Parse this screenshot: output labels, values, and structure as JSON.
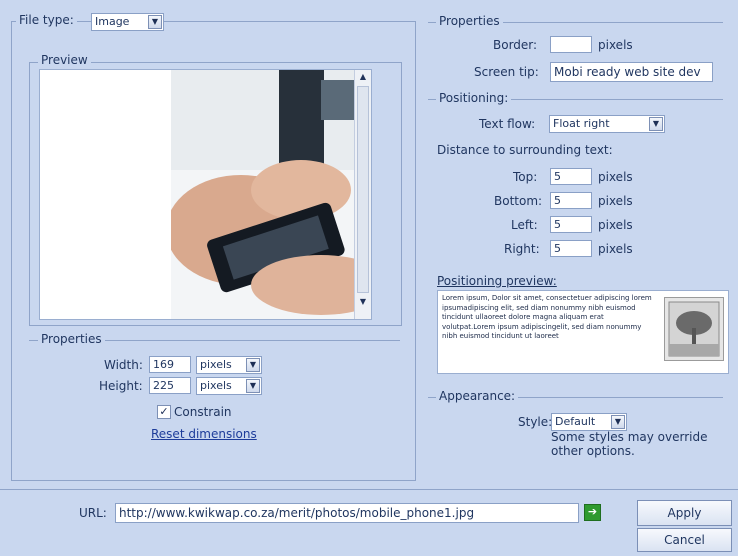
{
  "file_type": {
    "label": "File type:",
    "value": "Image"
  },
  "preview": {
    "legend": "Preview"
  },
  "left_properties": {
    "legend": "Properties",
    "width_label": "Width:",
    "width_value": "169",
    "width_unit": "pixels",
    "height_label": "Height:",
    "height_value": "225",
    "height_unit": "pixels",
    "constrain_label": "Constrain",
    "constrain_checked": true,
    "reset_label": "Reset dimensions"
  },
  "right_properties": {
    "legend": "Properties",
    "border_label": "Border:",
    "border_value": "",
    "border_unit": "pixels",
    "screentip_label": "Screen tip:",
    "screentip_value": "Mobi ready web site dev"
  },
  "positioning": {
    "legend": "Positioning:",
    "textflow_label": "Text flow:",
    "textflow_value": "Float right",
    "distance_label": "Distance to surrounding text:",
    "top_label": "Top:",
    "top_value": "5",
    "bottom_label": "Bottom:",
    "bottom_value": "5",
    "left_label": "Left:",
    "left_value": "5",
    "right_label": "Right:",
    "right_value": "5",
    "unit": "pixels",
    "preview_label": "Positioning preview:",
    "preview_text": "Lorem ipsum, Dolor sit amet, consectetuer adipiscing lorem ipsumadipiscing elit, sed diam nonummy nibh euismod tincidunt ullaoreet dolore magna aliquam erat volutpat.Lorem ipsum adipiscingelit, sed diam nonummy nibh euismod tincidunt ut laoreet"
  },
  "appearance": {
    "legend": "Appearance:",
    "style_label": "Style:",
    "style_value": "Default",
    "note": "Some styles may override other options."
  },
  "url": {
    "label": "URL:",
    "value": "http://www.kwikwap.co.za/merit/photos/mobile_phone1.jpg"
  },
  "buttons": {
    "apply": "Apply",
    "cancel": "Cancel"
  },
  "icons": {
    "dropdown": "chevron-down-icon",
    "go": "arrow-right-icon",
    "check": "checkmark-icon"
  },
  "colors": {
    "background": "#c9d7ef",
    "border": "#8fa4c9",
    "link": "#1d3c9a",
    "go_green": "#2f9a2f"
  }
}
